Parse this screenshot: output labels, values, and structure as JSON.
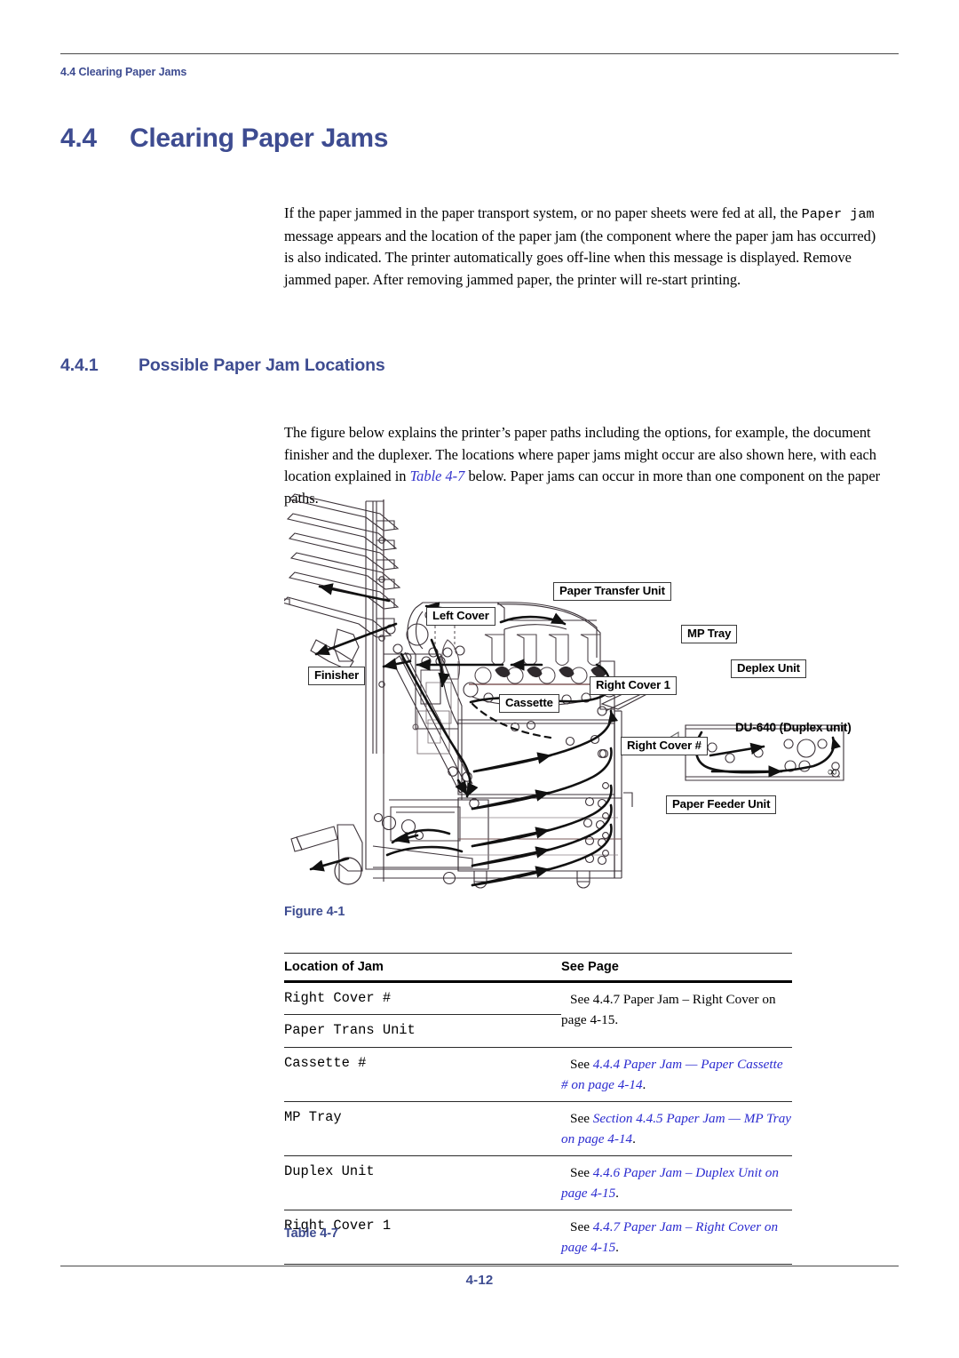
{
  "running_header": "4.4 Clearing Paper Jams",
  "heading1": {
    "number": "4.4",
    "text": "Clearing Paper Jams"
  },
  "heading2": {
    "number": "4.4.1",
    "text": "Possible Paper Jam Locations"
  },
  "paragraphs": {
    "intro_part1": "If the paper jammed in the paper transport system, or no paper sheets were fed at all, the ",
    "intro_mono": "Paper jam",
    "intro_part2": " message appears and the location of the paper jam (the component where the paper jam has occurred) is also indicated. The printer automatically goes off-line when this message is displayed. Remove jammed paper. After removing jammed paper, the printer will re-start printing.",
    "figure_part1": "The figure below explains the printer’s paper paths including the options, for example, the document finisher and the duplexer. The locations where paper jams might occur are also shown here, with each location explained in ",
    "figure_xref": "Table 4-7",
    "figure_part2": " below. Paper jams can occur in more than one component on the paper paths."
  },
  "figure": {
    "caption": "Figure 4-1",
    "callouts": {
      "paper_transfer_unit": "Paper Transfer Unit",
      "left_cover": "Left Cover",
      "mp_tray": "MP Tray",
      "finisher": "Finisher",
      "deplex_unit": "Deplex Unit",
      "right_cover_1": "Right Cover 1",
      "cassette": "Cassette",
      "right_cover_hash": "Right Cover #",
      "du640": "DU-640 (Duplex unit)",
      "paper_feeder_unit": "Paper Feeder Unit"
    }
  },
  "table": {
    "caption": "Table 4-7",
    "headers": {
      "left": "Location of Jam",
      "right": "See Page"
    },
    "merged_group": {
      "locations": [
        "Right Cover #",
        "Paper Trans Unit"
      ],
      "see_label": "See ",
      "reference": "4.4.7 Paper Jam – Right Cover on page 4-15",
      "period": "."
    },
    "rows": [
      {
        "location": "Cassette #",
        "see_label": "See ",
        "reference": "4.4.4 Paper Jam — Paper Cassette # on page 4-14",
        "period": "."
      },
      {
        "location": "MP Tray",
        "see_label": "See ",
        "reference": "Section 4.4.5 Paper Jam — MP Tray on page 4-14",
        "period": "."
      },
      {
        "location": "Duplex Unit",
        "see_label": "See ",
        "reference": "4.4.6 Paper Jam – Duplex Unit on page 4-15",
        "period": "."
      },
      {
        "location": "Right Cover 1",
        "see_label": "See ",
        "reference": "4.4.7 Paper Jam – Right Cover on page 4-15",
        "period": "."
      }
    ]
  },
  "footer": {
    "page_number": "4-12"
  },
  "colors": {
    "heading_blue": "#3e4c91",
    "link_blue": "#2b2bd0",
    "rule_gray": "#4a4a4a"
  }
}
